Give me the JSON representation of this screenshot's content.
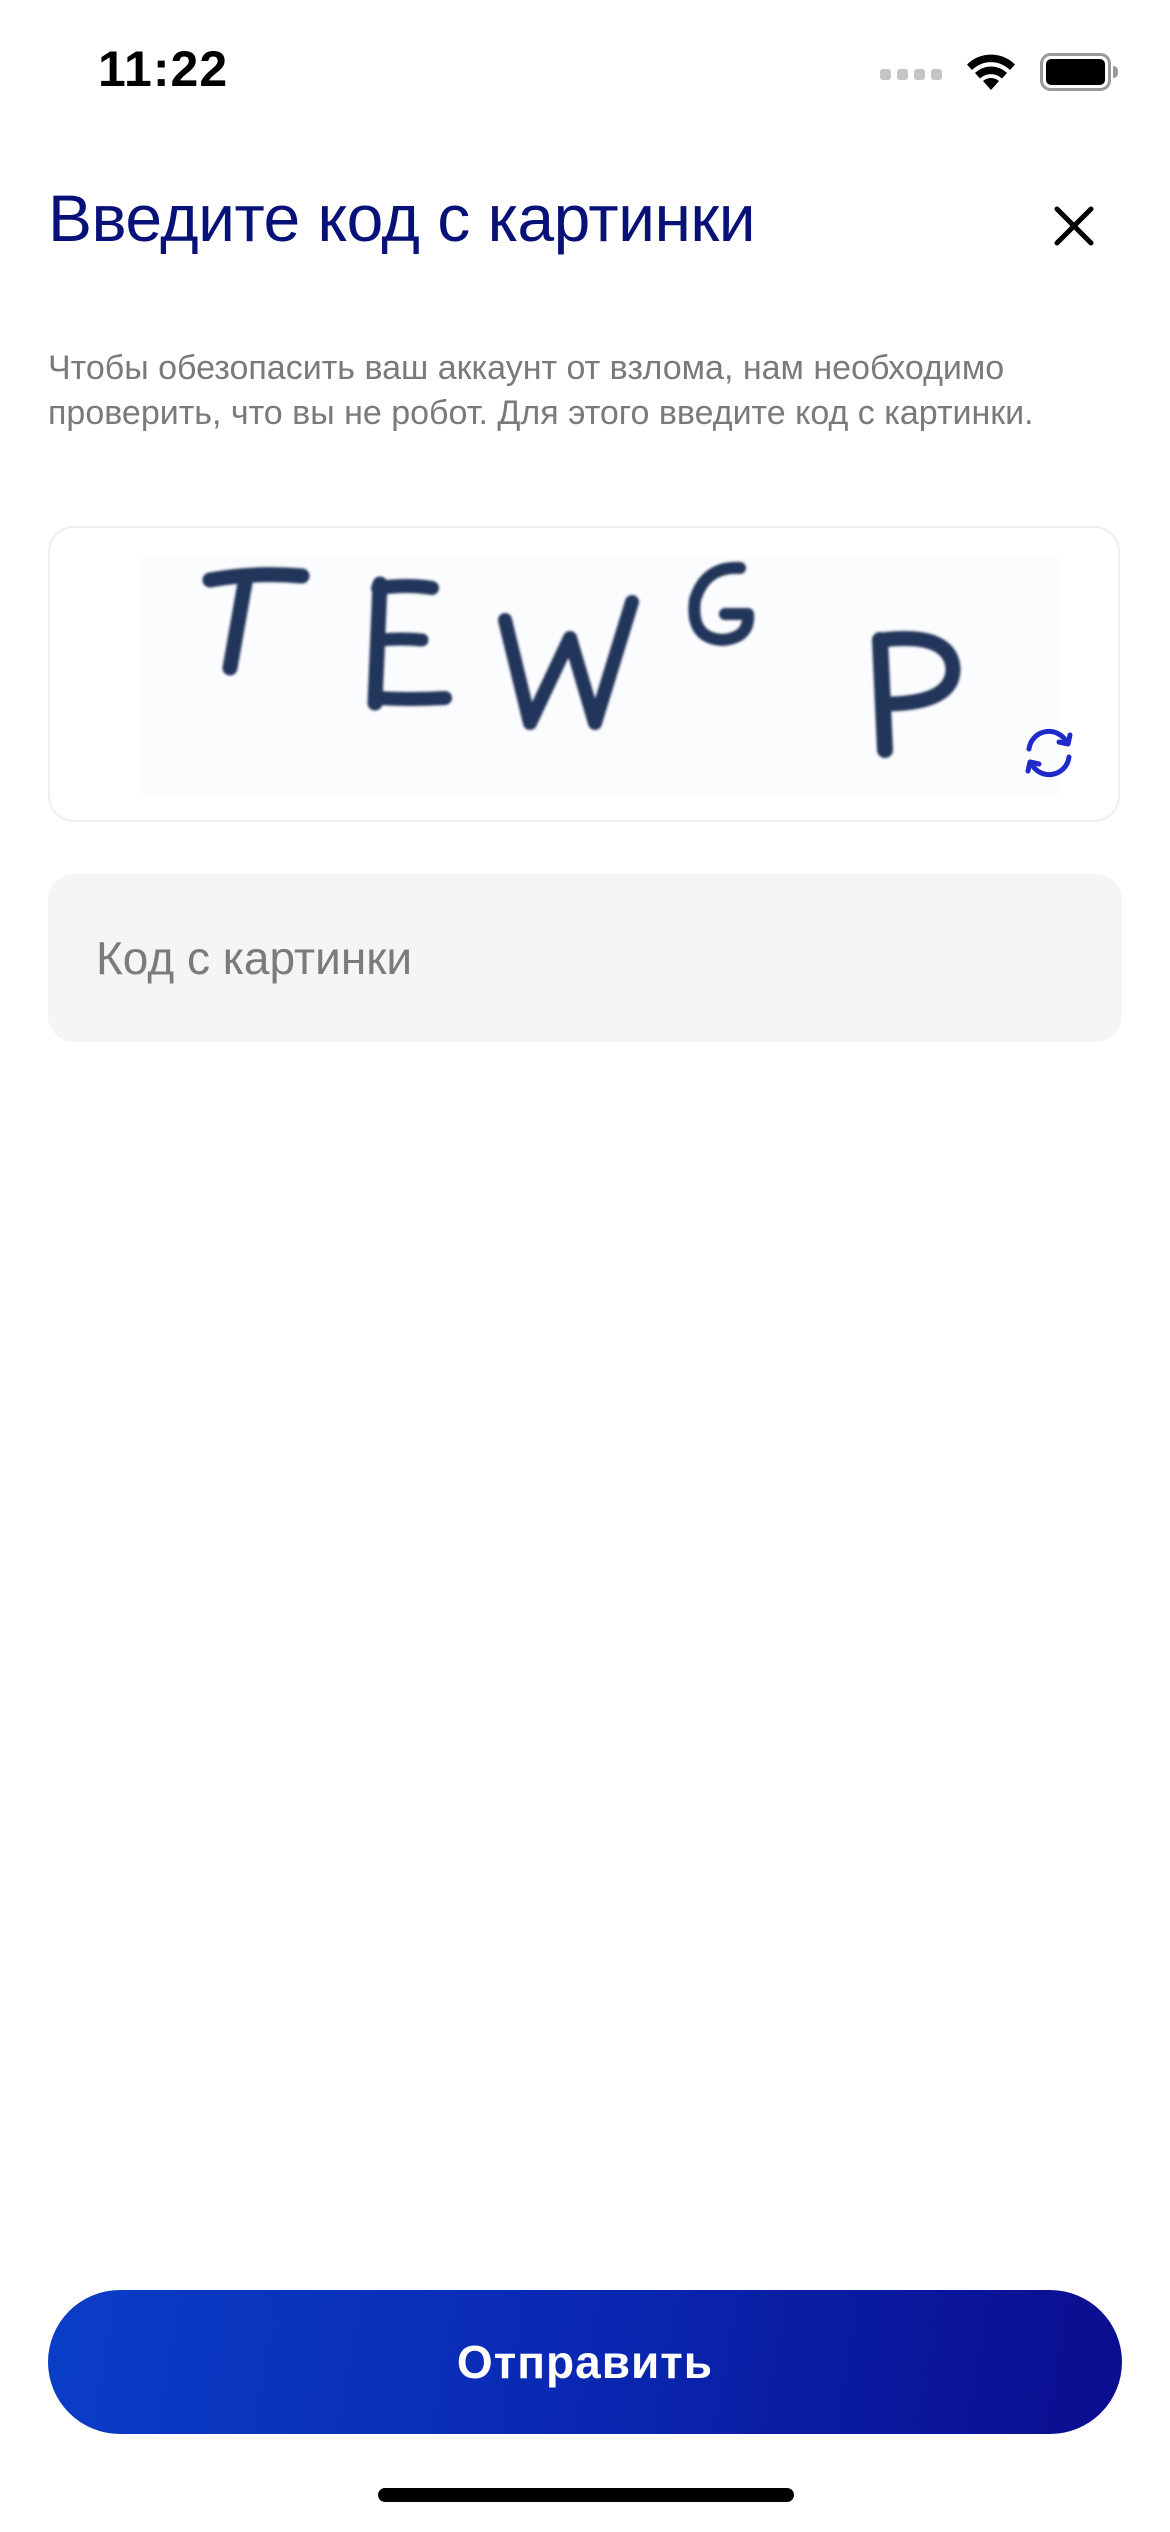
{
  "status_bar": {
    "time": "11:22",
    "icons": [
      "signal-dots-icon",
      "wifi-icon",
      "battery-icon"
    ]
  },
  "header": {
    "title": "Введите код с картинки",
    "close_icon": "close-icon"
  },
  "description": "Чтобы обезопасить ваш аккаунт от взлома, нам необходимо проверить, что вы не робот. Для этого введите код с картинки.",
  "captcha": {
    "code_text": "TEWG P",
    "refresh_icon": "refresh-icon"
  },
  "input": {
    "placeholder": "Код с картинки",
    "value": ""
  },
  "submit_button": {
    "label": "Отправить"
  },
  "colors": {
    "title": "#071177",
    "accent": "#1e2bc8",
    "button_gradient_start": "#0a3ec7",
    "button_gradient_end": "#0b0d8e",
    "input_background": "#f5f5f5",
    "description": "#7a7a7a"
  }
}
